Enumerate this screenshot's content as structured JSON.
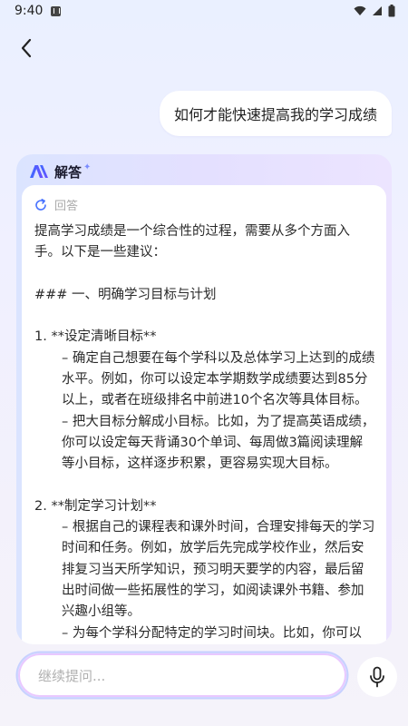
{
  "status_bar": {
    "time": "9:40"
  },
  "question": "如何才能快速提高我的学习成绩",
  "answer": {
    "title": "解答",
    "reply_label": "回答",
    "paragraphs": [
      {
        "text": "提高学习成绩是一个综合性的过程，需要从多个方面入手。以下是一些建议：",
        "indent": false
      },
      {
        "text": "",
        "indent": false
      },
      {
        "text": "### 一、明确学习目标与计划",
        "indent": false
      },
      {
        "text": "",
        "indent": false
      },
      {
        "text": "1. **设定清晰目标**",
        "indent": false
      },
      {
        "text": "– 确定自己想要在每个学科以及总体学习上达到的成绩水平。例如，你可以设定本学期数学成绩要达到85分以上，或者在班级排名中前进10个名次等具体目标。",
        "indent": true
      },
      {
        "text": "– 把大目标分解成小目标。比如，为了提高英语成绩，你可以设定每天背诵30个单词、每周做3篇阅读理解等小目标，这样逐步积累，更容易实现大目标。",
        "indent": true
      },
      {
        "text": "",
        "indent": false
      },
      {
        "text": "2. **制定学习计划**",
        "indent": false
      },
      {
        "text": "– 根据自己的课程表和课外时间，合理安排每天的学习时间和任务。例如，放学后先完成学校作业，然后安排复习当天所学知识，预习明天要学的内容，最后留出时间做一些拓展性的学习，如阅读课外书籍、参加兴趣小组等。",
        "indent": true
      },
      {
        "text": "– 为每个学科分配特定的学习时间块。比如，你可以",
        "indent": true
      }
    ]
  },
  "input": {
    "placeholder": "继续提问..."
  },
  "colors": {
    "accent": "#4a5cff",
    "card_gradient_start": "#dbe4ff",
    "card_gradient_end": "#ece4ff"
  },
  "icons": [
    "back-arrow-icon",
    "ai-logo-icon",
    "sparkle-icon",
    "refresh-icon",
    "microphone-icon",
    "wifi-icon",
    "signal-icon",
    "battery-icon"
  ]
}
